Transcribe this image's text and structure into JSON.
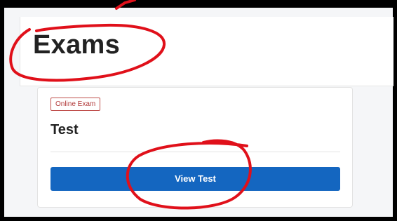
{
  "page": {
    "title": "Exams"
  },
  "exam_card": {
    "badge": "Online Exam",
    "title": "Test",
    "button_label": "View Test"
  },
  "colors": {
    "accent": "#1466c0",
    "badge_text": "#b23a3a",
    "annotation": "#e0101a"
  }
}
